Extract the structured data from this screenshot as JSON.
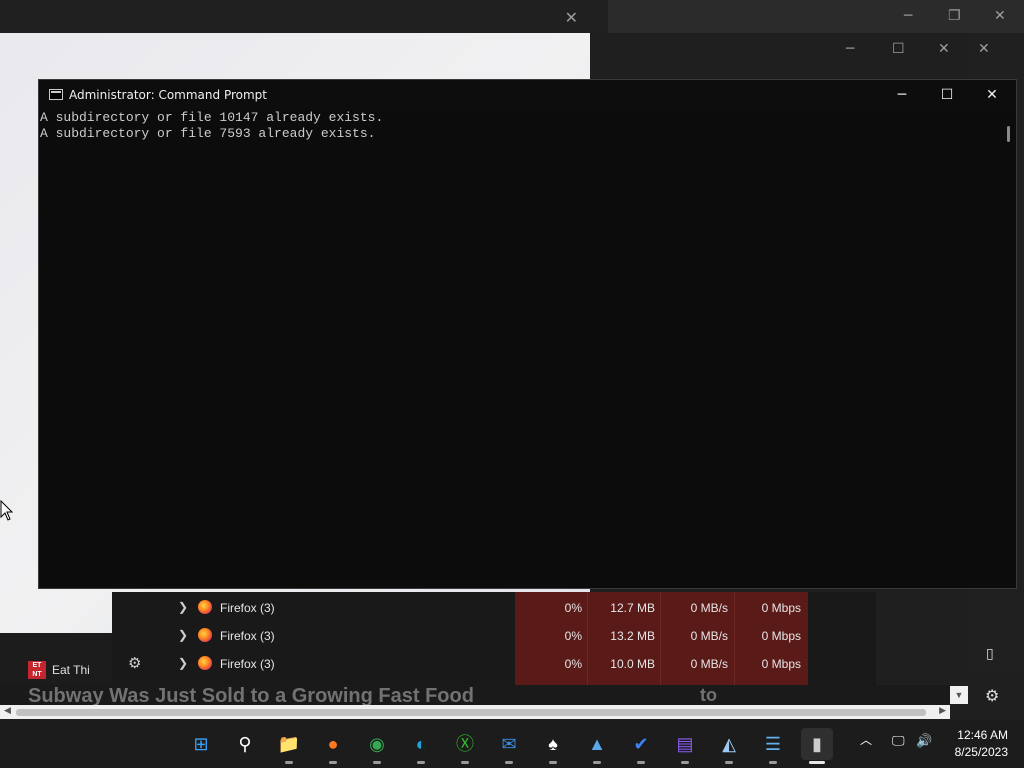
{
  "cmd": {
    "title": "Administrator: Command Prompt",
    "lines": [
      "A subdirectory or file 10147 already exists.",
      "A subdirectory or file 7593 already exists."
    ],
    "minimize": "─",
    "maximize": "☐",
    "close": "✕"
  },
  "background": {
    "site_name": "Eat Thi",
    "site_logo": "ET NT",
    "headline": "Subway Was Just Sold to a Growing Fast Food",
    "headline_right": "to",
    "close_glyph": "✕"
  },
  "task_manager": {
    "rows": [
      {
        "name": "Firefox (3)",
        "cpu": "0%",
        "memory": "12.7 MB",
        "disk": "0 MB/s",
        "network": "0 Mbps"
      },
      {
        "name": "Firefox (3)",
        "cpu": "0%",
        "memory": "13.2 MB",
        "disk": "0 MB/s",
        "network": "0 Mbps"
      },
      {
        "name": "Firefox (3)",
        "cpu": "0%",
        "memory": "10.0 MB",
        "disk": "0 MB/s",
        "network": "0 Mbps"
      }
    ],
    "heat_color": "#5a1a18"
  },
  "taskbar": {
    "apps": [
      {
        "name": "start-icon",
        "glyph": "⊞",
        "color": "#3aa0f3"
      },
      {
        "name": "search-icon",
        "glyph": "⚲",
        "color": "#ffffff"
      },
      {
        "name": "file-explorer-icon",
        "glyph": "📁",
        "color": "#f3c24a"
      },
      {
        "name": "firefox-icon",
        "glyph": "●",
        "color": "#ff7a1e"
      },
      {
        "name": "chrome-icon",
        "glyph": "◉",
        "color": "#34a853"
      },
      {
        "name": "edge-icon",
        "glyph": "◐",
        "color": "#1fa3d8"
      },
      {
        "name": "xbox-icon",
        "glyph": "Ⓧ",
        "color": "#2dbe2d"
      },
      {
        "name": "mail-icon",
        "glyph": "✉",
        "color": "#3b8de0"
      },
      {
        "name": "solitaire-icon",
        "glyph": "♠",
        "color": "#ffffff"
      },
      {
        "name": "photos-icon",
        "glyph": "▲",
        "color": "#5aa8e8"
      },
      {
        "name": "todo-icon",
        "glyph": "✔",
        "color": "#3a82f6"
      },
      {
        "name": "clipchamp-icon",
        "glyph": "▤",
        "color": "#8b5cf6"
      },
      {
        "name": "resource-monitor-icon",
        "glyph": "◭",
        "color": "#9ec9f0"
      },
      {
        "name": "notepad-icon",
        "glyph": "☰",
        "color": "#5fb0f0"
      },
      {
        "name": "command-prompt-icon",
        "glyph": "▮",
        "color": "#cccccc"
      }
    ],
    "time": "12:46 AM",
    "date": "8/25/2023"
  }
}
